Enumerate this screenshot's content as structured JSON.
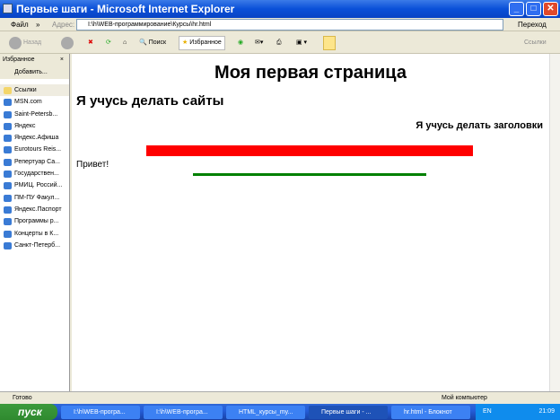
{
  "window": {
    "title": "Первые шаги - Microsoft Internet Explorer"
  },
  "menu": {
    "file": "Файл",
    "more": "»",
    "address_label": "Адрес:",
    "address": "I:\\h\\WEB-программирование\\Курсы\\hr.html",
    "go": "Переход"
  },
  "toolbar": {
    "back": "Назад",
    "search": "Поиск",
    "favorites": "Избранное",
    "links": "Ссылки"
  },
  "sidebar": {
    "title": "Избранное",
    "add": "Добавить...",
    "items": [
      "Ссылки",
      "MSN.com",
      "Saint-Petersb...",
      "Яндекс",
      "Яндекс.Афиша",
      "Eurotours Reis...",
      "Репертуар Са...",
      "Государствен...",
      "РМИЦ. Россий...",
      "ПМ-ПУ  Факул...",
      "Яндекс.Паспорт",
      "Программы р...",
      "Концерты в К...",
      "Санкт-Петерб..."
    ]
  },
  "page": {
    "h1": "Моя первая страница",
    "h2": "Я учусь делать сайты",
    "h3": "Я учусь делать заголовки",
    "text": "Привет!",
    "red": "#ff0000",
    "green": "#008000"
  },
  "status": {
    "text": "Готово",
    "zone": "Мой компьютер"
  },
  "taskbar": {
    "start": "пуск",
    "tasks": [
      "I:\\h\\WEB-програ...",
      "I:\\h\\WEB-програ...",
      "HTML_курсы_my...",
      "Первые шаги - ...",
      "hr.html - Блокнот"
    ],
    "lang": "EN",
    "clock": "21:09"
  }
}
